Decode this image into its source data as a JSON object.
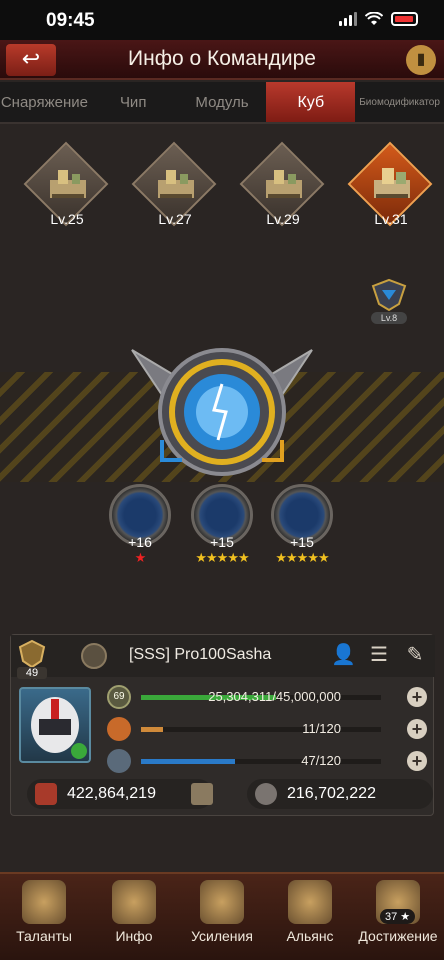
{
  "status_bar": {
    "time": "09:45"
  },
  "header": {
    "title": "Инфо о Командире",
    "back_icon": "back-arrow-icon",
    "stats_icon": "bar-chart-icon"
  },
  "tabs": [
    {
      "label": "Снаряжение",
      "active": false
    },
    {
      "label": "Чип",
      "active": false
    },
    {
      "label": "Модуль",
      "active": false
    },
    {
      "label": "Куб",
      "active": true
    },
    {
      "label": "Биомодификатор",
      "active": false
    }
  ],
  "buildings": [
    {
      "level": "Lv.25",
      "selected": false
    },
    {
      "level": "Lv.27",
      "selected": false
    },
    {
      "level": "Lv.29",
      "selected": false
    },
    {
      "level": "Lv.31",
      "selected": true
    }
  ],
  "cube_badge": {
    "level": "Lv.8"
  },
  "modules": [
    {
      "value": "+16",
      "stars": "★",
      "star_color": "red"
    },
    {
      "value": "+15",
      "stars": "★★★★★",
      "star_color": "gold"
    },
    {
      "value": "+15",
      "stars": "★★★★★",
      "star_color": "gold"
    }
  ],
  "commander": {
    "rank_level": "49",
    "name": "[SSS]  Pro100Sasha",
    "xp_level": "69",
    "xp": "25,304,311/45,000,000",
    "xp_fraction": 0.562,
    "stamina": "11/120",
    "stamina_fraction": 0.092,
    "energy": "47/120",
    "energy_fraction": 0.392,
    "power": "422,864,219",
    "kills": "216,702,222"
  },
  "nav": [
    {
      "label": "Таланты"
    },
    {
      "label": "Инфо"
    },
    {
      "label": "Усиления"
    },
    {
      "label": "Альянс"
    },
    {
      "label": "Достижение"
    }
  ],
  "achievement_count": "37 ★",
  "colors": {
    "accent": "#b8392c",
    "xp_bar": "#3aa83a",
    "stamina_bar": "#d08a3a",
    "energy_bar": "#2a7ac8",
    "star_gold": "#f0c020"
  }
}
